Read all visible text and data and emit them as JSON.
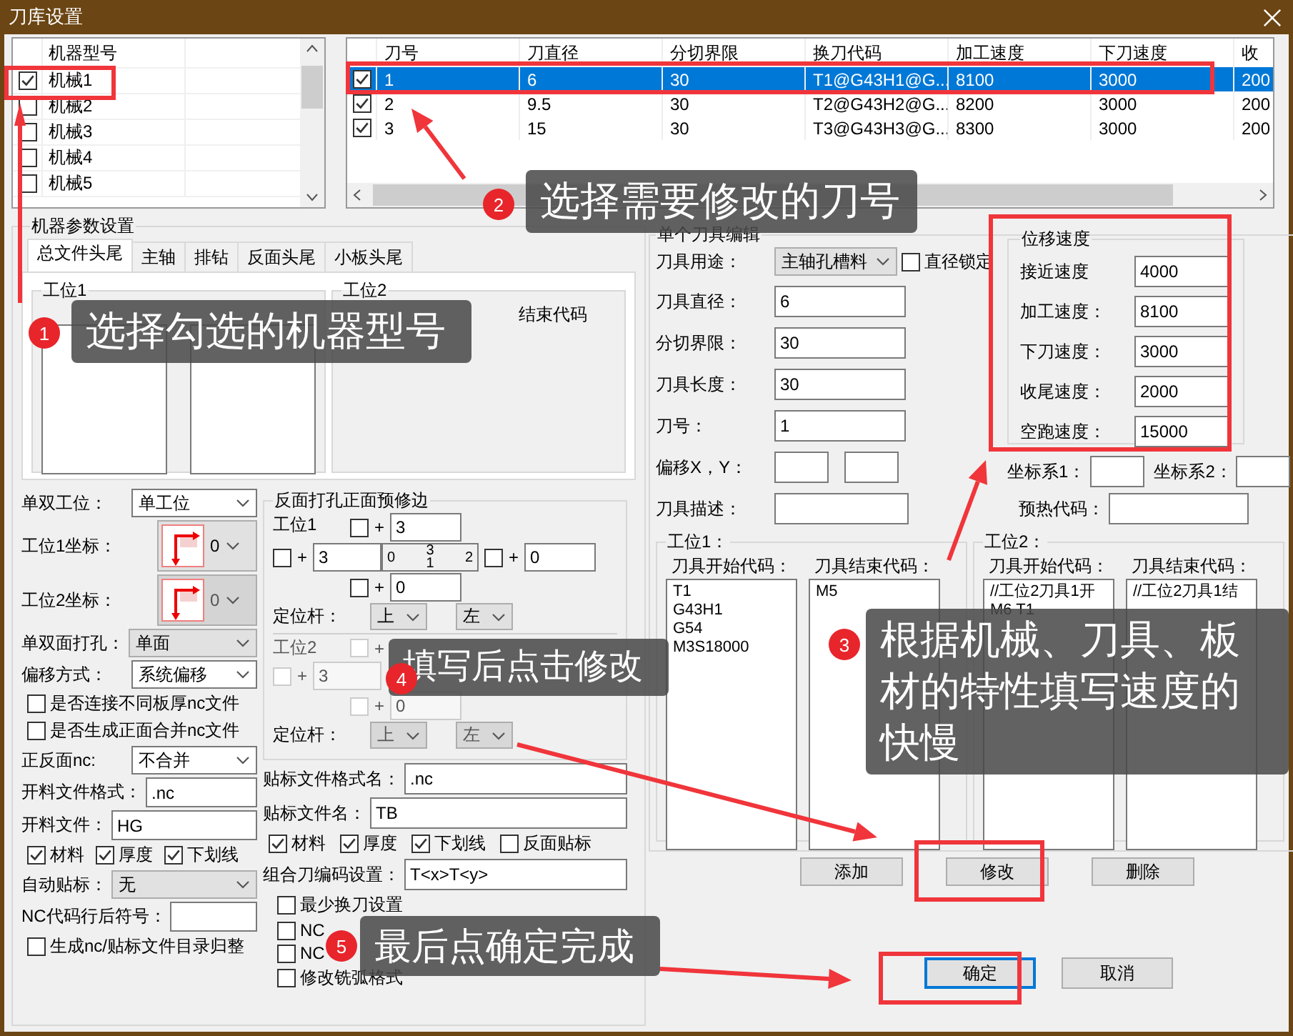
{
  "window": {
    "title": "刀库设置"
  },
  "machine_list": {
    "header": "机器型号",
    "items": [
      {
        "label": "机械1",
        "checked": true
      },
      {
        "label": "机械2",
        "checked": false
      },
      {
        "label": "机械3",
        "checked": false
      },
      {
        "label": "机械4",
        "checked": false
      },
      {
        "label": "机械5",
        "checked": false
      }
    ]
  },
  "tool_table": {
    "columns": [
      "刀号",
      "刀直径",
      "分切界限",
      "换刀代码",
      "加工速度",
      "下刀速度",
      "收"
    ],
    "rows": [
      {
        "checked": true,
        "selected": true,
        "cells": [
          "1",
          "6",
          "30",
          "T1@G43H1@G...",
          "8100",
          "3000",
          "200"
        ]
      },
      {
        "checked": true,
        "selected": false,
        "cells": [
          "2",
          "9.5",
          "30",
          "T2@G43H2@G...",
          "8200",
          "3000",
          "200"
        ]
      },
      {
        "checked": true,
        "selected": false,
        "cells": [
          "3",
          "15",
          "30",
          "T3@G43H3@G...",
          "8300",
          "3000",
          "200"
        ]
      }
    ]
  },
  "machine_params": {
    "title": "机器参数设置",
    "tabs": [
      {
        "label": "总文件头尾",
        "selected": true
      },
      {
        "label": "主轴",
        "selected": false
      },
      {
        "label": "排钻",
        "selected": false
      },
      {
        "label": "反面头尾",
        "selected": false
      },
      {
        "label": "小板头尾",
        "selected": false
      }
    ],
    "stations": [
      {
        "title": "工位1",
        "kind": "fields"
      },
      {
        "title": "工位2",
        "kind": "labels",
        "end_label": "结束代码"
      }
    ],
    "settings": [
      {
        "kind": "select",
        "label": "单双工位：",
        "value": "单工位"
      },
      {
        "kind": "coord",
        "label": "工位1坐标：",
        "value": "0",
        "disabled": false
      },
      {
        "kind": "coord",
        "label": "工位2坐标：",
        "value": "0",
        "disabled": true
      },
      {
        "kind": "dropdown",
        "label": "单双面打孔：",
        "value": "单面"
      },
      {
        "kind": "select",
        "label": "偏移方式：",
        "value": "系统偏移"
      },
      {
        "kind": "checkbox",
        "label": "是否连接不同板厚nc文件",
        "checked": false
      },
      {
        "kind": "checkbox",
        "label": "是否生成正面合并nc文件",
        "checked": false
      },
      {
        "kind": "select",
        "label": "正反面nc:",
        "value": "不合并"
      },
      {
        "kind": "input",
        "label": "开料文件格式：",
        "value": ".nc"
      },
      {
        "kind": "input",
        "label": "开料文件：",
        "value": "HG"
      },
      {
        "kind": "checks",
        "items": [
          {
            "label": "材料",
            "checked": true
          },
          {
            "label": "厚度",
            "checked": true
          },
          {
            "label": "下划线",
            "checked": true
          }
        ]
      },
      {
        "kind": "dropdown",
        "label": "自动贴标：",
        "value": "无"
      },
      {
        "kind": "input",
        "label": "NC代码行后符号："
      },
      {
        "kind": "checkbox",
        "label": "生成nc/贴标文件目录归整",
        "checked": false
      }
    ],
    "trim": {
      "title": "反面打孔正面预修边",
      "stations": [
        {
          "title": "工位1",
          "disabled": false,
          "top": {
            "checked": false,
            "sign": "+",
            "value": "3"
          },
          "left": {
            "checked": false,
            "sign": "+",
            "value": "3"
          },
          "right": {
            "checked": false,
            "sign": "+",
            "value": "0"
          },
          "bottom": {
            "checked": false,
            "sign": "+",
            "value": "0"
          },
          "center": [
            "0",
            "3",
            "1",
            "2"
          ],
          "rod_label": "定位杆：",
          "rod": [
            "上",
            "左"
          ]
        },
        {
          "title": "工位2",
          "disabled": true,
          "top": {
            "checked": false,
            "sign": "+"
          },
          "left": {
            "checked": false,
            "sign": "+",
            "value": "3"
          },
          "bottom": {
            "checked": false,
            "sign": "+",
            "value": "0"
          },
          "rod_label": "定位杆：",
          "rod": [
            "上",
            "左"
          ]
        }
      ]
    },
    "label_fields": [
      {
        "label": "贴标文件格式名：",
        "value": ".nc"
      },
      {
        "label": "贴标文件名：",
        "value": "TB"
      }
    ],
    "label_checks": [
      {
        "label": "材料",
        "checked": true
      },
      {
        "label": "厚度",
        "checked": true
      },
      {
        "label": "下划线",
        "checked": true
      },
      {
        "label": "反面贴标",
        "checked": false
      }
    ],
    "code_setting": {
      "label": "组合刀编码设置：",
      "value": "T<x>T<y>"
    },
    "options": [
      {
        "label": "最少换刀设置",
        "checked": false
      },
      {
        "label": "NC",
        "checked": false
      },
      {
        "label": "NC",
        "checked": false
      },
      {
        "label": "修改铣弧格式",
        "checked": false
      }
    ]
  },
  "tool_edit": {
    "title": "单个刀具编辑",
    "usage": {
      "label": "刀具用途：",
      "value": "主轴孔槽料"
    },
    "lock": {
      "label": "直径锁定",
      "checked": false
    },
    "fields": [
      {
        "label": "刀具直径：",
        "value": "6"
      },
      {
        "label": "分切界限：",
        "value": "30"
      },
      {
        "label": "刀具长度：",
        "value": "30"
      },
      {
        "label": "刀号：",
        "value": "1"
      }
    ],
    "offset_label": "偏移X，Y：",
    "desc_label": "刀具描述：",
    "speeds": {
      "title": "位移速度",
      "fields": [
        {
          "label": "接近速度",
          "value": "4000"
        },
        {
          "label": "加工速度：",
          "value": "8100"
        },
        {
          "label": "下刀速度：",
          "value": "3000"
        },
        {
          "label": "收尾速度：",
          "value": "2000"
        },
        {
          "label": "空跑速度：",
          "value": "15000"
        }
      ]
    },
    "coord1_label": "坐标系1：",
    "coord2_label": "坐标系2：",
    "preheat_label": "预热代码：",
    "stations": [
      {
        "title": "工位1：",
        "start_label": "刀具开始代码：",
        "start": "T1\nG43H1\nG54\nM3S18000",
        "end_label": "刀具结束代码：",
        "end": "M5"
      },
      {
        "title": "工位2：",
        "start_label": "刀具开始代码：",
        "start": "//工位2刀具1开\nM6 T1",
        "end_label": "刀具结束代码：",
        "end": "//工位2刀具1结"
      }
    ]
  },
  "edit_buttons": [
    "添加",
    "修改",
    "删除"
  ],
  "dialog_buttons": [
    {
      "label": "确定",
      "default": true
    },
    {
      "label": "取消",
      "default": false
    }
  ],
  "callouts": [
    {
      "number": "1",
      "text": "选择勾选的机器型号"
    },
    {
      "number": "2",
      "text": "选择需要修改的刀号"
    },
    {
      "number": "3",
      "text": "根据机械、刀具、板材的特性填写速度的快慢"
    },
    {
      "number": "4",
      "text": "填写后点击修改"
    },
    {
      "number": "5",
      "text": "最后点确定完成"
    }
  ]
}
